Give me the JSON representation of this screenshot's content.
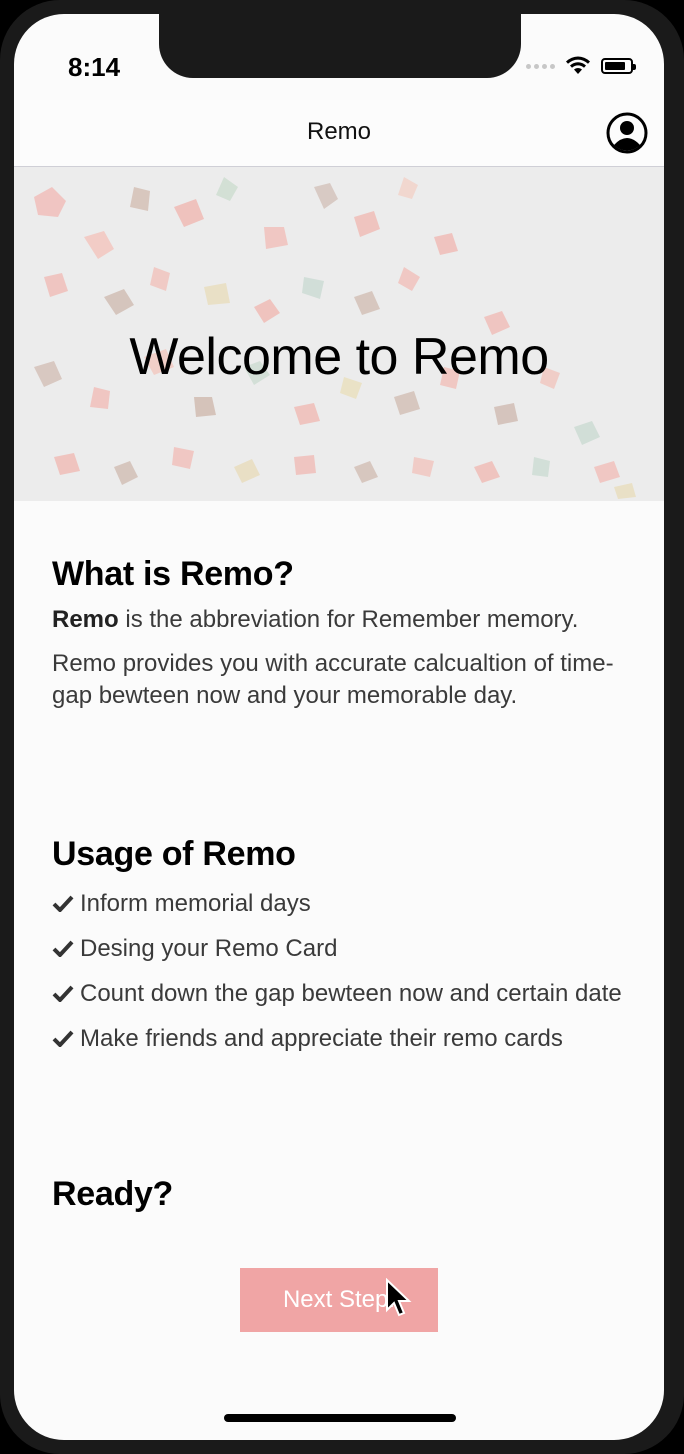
{
  "status_bar": {
    "time": "8:14"
  },
  "navbar": {
    "title": "Remo",
    "account_icon": "account-circle-icon"
  },
  "hero": {
    "title": "Welcome to Remo"
  },
  "what_section": {
    "heading": "What is Remo?",
    "bold_word": "Remo",
    "line1_rest": " is the abbreviation for Remember memory.",
    "line2": "Remo provides you with accurate calcualtion of time-gap bewteen now and your memorable day."
  },
  "usage_section": {
    "heading": "Usage of Remo",
    "items": [
      "Inform memorial days",
      "Desing your Remo Card",
      "Count down the gap bewteen now and certain date",
      "Make friends and appreciate their remo cards"
    ]
  },
  "ready_section": {
    "heading": "Ready?"
  },
  "next_button": {
    "label": "Next Step."
  },
  "colors": {
    "button": "#f0a5a5",
    "background": "#fbfbfb"
  }
}
